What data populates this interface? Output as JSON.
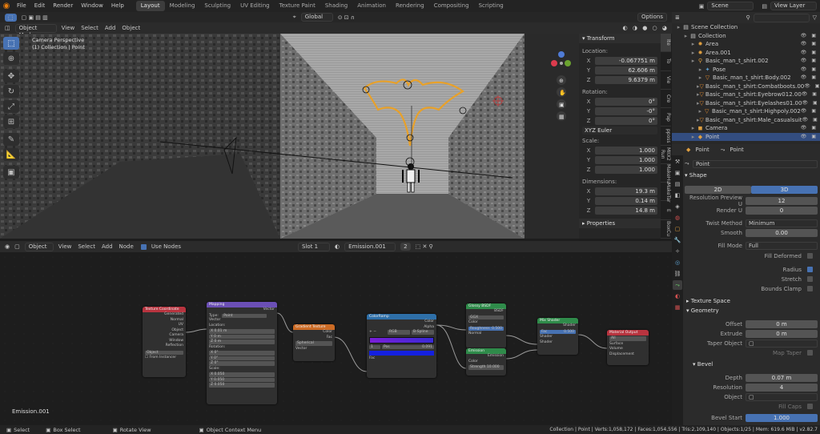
{
  "menu": [
    "File",
    "Edit",
    "Render",
    "Window",
    "Help"
  ],
  "workspaces": [
    "Layout",
    "Modeling",
    "Sculpting",
    "UV Editing",
    "Texture Paint",
    "Shading",
    "Animation",
    "Rendering",
    "Compositing",
    "Scripting"
  ],
  "scene_name": "Scene",
  "view_layer": "View Layer",
  "vp_header": {
    "mode": "Object Mode",
    "items": [
      "View",
      "Select",
      "Add",
      "Object"
    ],
    "orientation": "Global",
    "options": "Options"
  },
  "vp_overlay": {
    "line1": "Camera Perspective",
    "line2": "(1) Collection | Point"
  },
  "transform": {
    "title": "Transform",
    "location_label": "Location:",
    "location": [
      "-0.067751 m",
      "62.606 m",
      "9.6379 m"
    ],
    "rotation_label": "Rotation:",
    "rotation": [
      "0°",
      "-0°",
      "0°"
    ],
    "euler": "XYZ Euler",
    "scale_label": "Scale:",
    "scale": [
      "1.000",
      "1.000",
      "1.000"
    ],
    "dimensions_label": "Dimensions:",
    "dimensions": [
      "19.3 m",
      "0.14 m",
      "14.8 m"
    ],
    "axes": [
      "X",
      "Y",
      "Z"
    ],
    "properties": "Properties"
  },
  "side_tabs": [
    "Ite",
    "To",
    "Vie",
    "Cre",
    "Pap",
    "pposs",
    "MIIX2 Run",
    "MakeHu",
    "MakeTar",
    "E",
    "BoxCu"
  ],
  "outliner": [
    {
      "name": "Scene Collection",
      "indent": 0,
      "icon": "▤",
      "color": "#ccc"
    },
    {
      "name": "Collection",
      "indent": 1,
      "icon": "▤",
      "color": "#ccc"
    },
    {
      "name": "Area",
      "indent": 2,
      "icon": "✹",
      "color": "#e0a040"
    },
    {
      "name": "Area.001",
      "indent": 2,
      "icon": "✹",
      "color": "#e0a040"
    },
    {
      "name": "Basic_man_t_shirt.002",
      "indent": 2,
      "icon": "⚲",
      "color": "#e0a040"
    },
    {
      "name": "Pose",
      "indent": 3,
      "icon": "✦",
      "color": "#5da0d0"
    },
    {
      "name": "Basic_man_t_shirt:Body.002",
      "indent": 3,
      "icon": "▽",
      "color": "#e08a30"
    },
    {
      "name": "Basic_man_t_shirt:Combatboots.00",
      "indent": 3,
      "icon": "▽",
      "color": "#e08a30"
    },
    {
      "name": "Basic_man_t_shirt:Eyebrow012.00",
      "indent": 3,
      "icon": "▽",
      "color": "#e08a30"
    },
    {
      "name": "Basic_man_t_shirt:Eyelashes01.00",
      "indent": 3,
      "icon": "▽",
      "color": "#e08a30"
    },
    {
      "name": "Basic_man_t_shirt:Highpoly.002",
      "indent": 3,
      "icon": "▽",
      "color": "#e08a30"
    },
    {
      "name": "Basic_man_t_shirt:Male_casualsuit",
      "indent": 3,
      "icon": "▽",
      "color": "#e08a30"
    },
    {
      "name": "Camera",
      "indent": 2,
      "icon": "◼",
      "color": "#e0a040"
    },
    {
      "name": "Point",
      "indent": 2,
      "icon": "◆",
      "color": "#e0a040"
    }
  ],
  "props": {
    "breadcrumb": [
      "Point",
      "Point"
    ],
    "datablock": "Point",
    "shape": "Shape",
    "tab2d": "2D",
    "tab3d": "3D",
    "res_preview_label": "Resolution Preview U",
    "res_preview": "12",
    "render_u_label": "Render U",
    "render_u": "0",
    "twist_label": "Twist Method",
    "twist": "Minimum",
    "smooth_label": "Smooth",
    "smooth": "0.00",
    "fill_mode_label": "Fill Mode",
    "fill_mode": "Full",
    "fill_deformed": "Fill Deformed",
    "radius": "Radius",
    "stretch": "Stretch",
    "bounds_clamp": "Bounds Clamp",
    "texture_space": "Texture Space",
    "geometry": "Geometry",
    "offset_label": "Offset",
    "offset": "0 m",
    "extrude_label": "Extrude",
    "extrude": "0 m",
    "taper_label": "Taper Object",
    "map_taper": "Map Taper",
    "bevel": "Bevel",
    "depth_label": "Depth",
    "depth": "0.07 m",
    "resolution_label": "Resolution",
    "resolution": "4",
    "object_label": "Object",
    "fill_caps": "Fill Caps",
    "bevel_start_label": "Bevel Start",
    "bevel_start": "1.000"
  },
  "node_header": {
    "type": "Object",
    "items": [
      "View",
      "Select",
      "Add",
      "Node"
    ],
    "use_nodes": "Use Nodes",
    "slot": "Slot 1",
    "material": "Emission.001",
    "users": "2"
  },
  "nodes": {
    "texcoord": {
      "title": "Texture Coordinate",
      "rows": [
        "Generated",
        "Normal",
        "UV",
        "Object",
        "Camera",
        "Window",
        "Reflection"
      ],
      "object": "Object",
      "from_instancer": "From Instancer"
    },
    "mapping": {
      "title": "Mapping",
      "vector_out": "Vector",
      "type_label": "Type:",
      "type": "Point",
      "vector": "Vector",
      "location": "Location:",
      "loc": [
        "X 0.01 m",
        "Y 0 m",
        "Z 0 m"
      ],
      "rotation": "Rotation:",
      "rot": [
        "X 0°",
        "Y 0°",
        "Z 0°"
      ],
      "scale": "Scale:",
      "scl": [
        "X 0.050",
        "Y 0.050",
        "Z 0.050"
      ]
    },
    "gradient": {
      "title": "Gradient Texture",
      "outs": [
        "Color",
        "Fac"
      ],
      "type": "Spherical",
      "vector": "Vector"
    },
    "colorramp": {
      "title": "ColorRamp",
      "outs": [
        "Color",
        "Alpha"
      ],
      "mode": "RGB",
      "interp": "B-Spline",
      "idx": "1",
      "pos_label": "Pos",
      "pos": "0.091",
      "fac": "Fac"
    },
    "principled": {
      "title": "Glossy BSDF",
      "bsdf": "BSDF",
      "dist": "GGX",
      "color": "Color",
      "roughness_label": "Roughness",
      "roughness": "0.500",
      "normal": "Normal"
    },
    "emission": {
      "title": "Emission",
      "out": "Emission",
      "color": "Color",
      "strength_label": "Strength",
      "strength": "10.000"
    },
    "mix": {
      "title": "Mix Shader",
      "out": "Shader",
      "fac_label": "Fac",
      "fac": "0.500",
      "in1": "Shader",
      "in2": "Shader"
    },
    "output": {
      "title": "Material Output",
      "target": "All",
      "ins": [
        "Surface",
        "Volume",
        "Displacement"
      ]
    }
  },
  "node_label": "Emission.001",
  "status": {
    "left": [
      "Select",
      "Box Select",
      "Rotate View",
      "Object Context Menu"
    ],
    "right": "Collection | Point | Verts:1,058,172 | Faces:1,054,556 | Tris:2,109,140 | Objects:1/25 | Mem: 619.6 MiB | v2.82.7"
  },
  "colors": {
    "accent": "#4772b3",
    "orange": "#e8a12a",
    "node_tex": "#b8343f",
    "node_vec": "#6b4fb5",
    "node_tex2": "#cc6b25",
    "node_conv": "#2e6fa8",
    "node_shader": "#2f8b4a",
    "node_out": "#b8343f"
  }
}
